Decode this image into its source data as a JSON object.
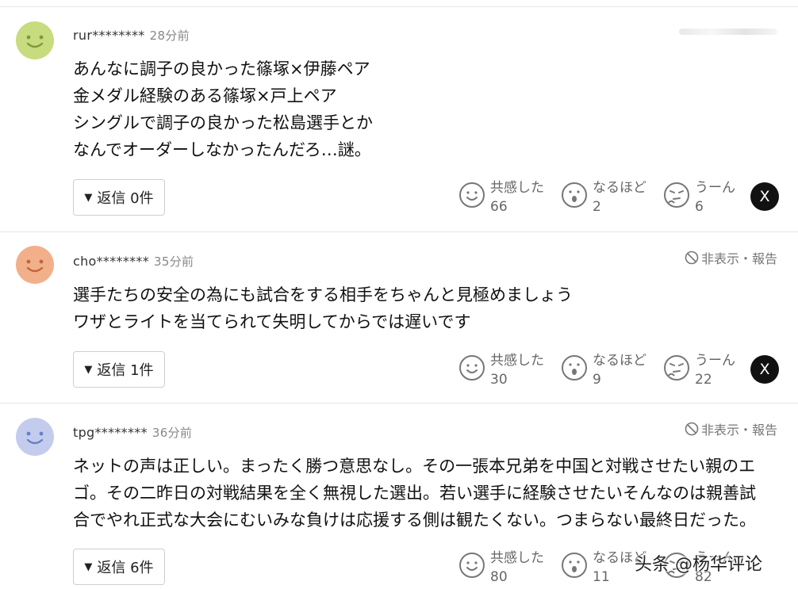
{
  "comments": [
    {
      "user": "rur********",
      "time": "28分前",
      "hide_label": "",
      "lines": [
        "あんなに調子の良かった篠塚×伊藤ペア",
        "金メダル経験のある篠塚×戸上ペア",
        "シングルで調子の良かった松島選手とか",
        "なんでオーダーしなかったんだろ…謎。"
      ],
      "reply_label": "返信 0件",
      "reactions": [
        {
          "label": "共感した",
          "count": "66"
        },
        {
          "label": "なるほど",
          "count": "2"
        },
        {
          "label": "うーん",
          "count": "6"
        }
      ],
      "avatar_color": "#c6dc7e"
    },
    {
      "user": "cho********",
      "time": "35分前",
      "hide_label": "非表示・報告",
      "lines": [
        "選手たちの安全の為にも試合をする相手をちゃんと見極めましょう",
        "ワザとライトを当てられて失明してからでは遅いです"
      ],
      "reply_label": "返信 1件",
      "reactions": [
        {
          "label": "共感した",
          "count": "30"
        },
        {
          "label": "なるほど",
          "count": "9"
        },
        {
          "label": "うーん",
          "count": "22"
        }
      ],
      "avatar_color": "#f2b08a"
    },
    {
      "user": "tpg********",
      "time": "36分前",
      "hide_label": "非表示・報告",
      "lines": [
        "ネットの声は正しい。まったく勝つ意思なし。その一張本兄弟を中国と対戦させたい親のエ",
        "ゴ。その二昨日の対戦結果を全く無視した選出。若い選手に経験させたいそんなのは親善試",
        "合でやれ正式な大会にむいみな負けは応援する側は観たくない。つまらない最終日だった。"
      ],
      "reply_label": "返信 6件",
      "reactions": [
        {
          "label": "共感した",
          "count": "80"
        },
        {
          "label": "なるほど",
          "count": "11"
        },
        {
          "label": "うーん",
          "count": "82"
        }
      ],
      "avatar_color": "#c4ccee"
    }
  ],
  "x_share": "X",
  "watermark": "头条 @杨华评论"
}
